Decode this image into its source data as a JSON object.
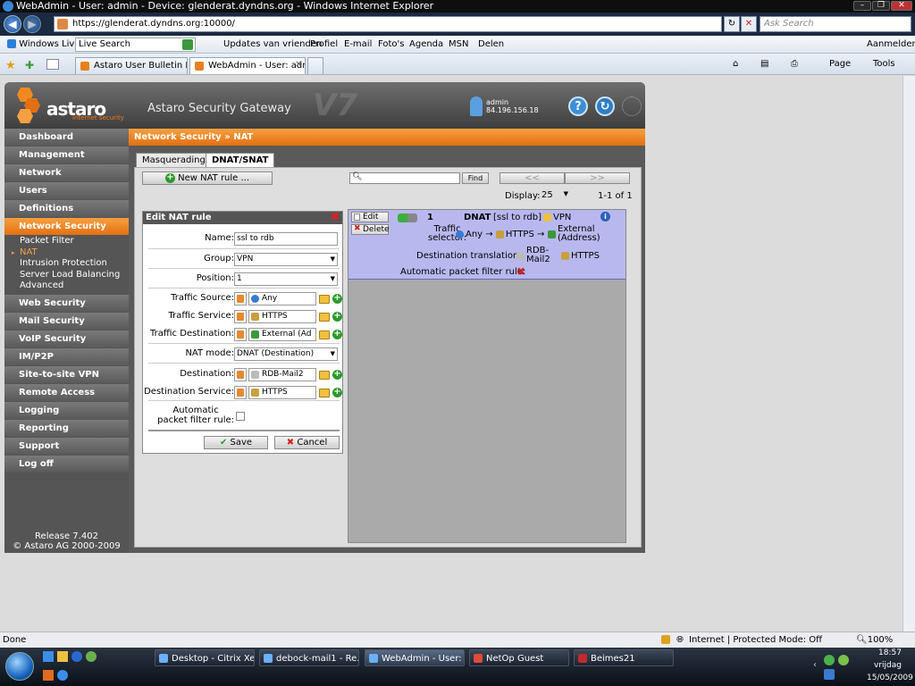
{
  "window": {
    "title": "WebAdmin - User: admin - Device: glenderat.dyndns.org - Windows Internet Explorer"
  },
  "browser": {
    "url": "https://glenderat.dyndns.org:10000/",
    "search_placeholder": "Ask Search",
    "links_toolbar": {
      "windows_live": "Windows Live",
      "live_search": "Live Search",
      "items": [
        "Updates van vrienden",
        "Profiel",
        "E-mail",
        "Foto's",
        "Agenda",
        "MSN",
        "Delen"
      ],
      "signin": "Aanmelden"
    },
    "tabs": [
      {
        "label": "Astaro User Bulletin Board ..."
      },
      {
        "label": "WebAdmin - User: adm..."
      }
    ],
    "cmd": {
      "page": "Page",
      "tools": "Tools"
    },
    "status": {
      "left": "Done",
      "zone": "Internet | Protected Mode: Off",
      "zoom": "100%"
    }
  },
  "app": {
    "brand": "astaro",
    "brand_sub": "internet security",
    "product": "Astaro Security Gateway",
    "version_big": "V7",
    "admin_user": "admin",
    "admin_ip": "84.196.156.18",
    "sidebar": [
      {
        "label": "Dashboard"
      },
      {
        "label": "Management"
      },
      {
        "label": "Network"
      },
      {
        "label": "Users"
      },
      {
        "label": "Definitions"
      },
      {
        "label": "Network Security"
      },
      {
        "label": "Web Security"
      },
      {
        "label": "Mail Security"
      },
      {
        "label": "VoIP Security"
      },
      {
        "label": "IM/P2P"
      },
      {
        "label": "Site-to-site VPN"
      },
      {
        "label": "Remote Access"
      },
      {
        "label": "Logging"
      },
      {
        "label": "Reporting"
      },
      {
        "label": "Support"
      },
      {
        "label": "Log off"
      }
    ],
    "subitems": [
      "Packet Filter",
      "NAT",
      "Intrusion Protection",
      "Server Load Balancing",
      "Advanced"
    ],
    "release": "Release 7.402",
    "copyright": "© Astaro AG 2000-2009",
    "breadcrumb": "Network Security » NAT",
    "tabs": [
      "Masquerading",
      "DNAT/SNAT"
    ],
    "new_rule_label": "New NAT rule ...",
    "find_label": "Find",
    "pager_prev": "<<",
    "pager_next": ">>",
    "display_label": "Display:",
    "display_value": "25",
    "count": "1-1 of 1",
    "edit": {
      "title": "Edit NAT rule",
      "name_label": "Name:",
      "name_value": "ssl to rdb",
      "group_label": "Group:",
      "group_value": "VPN",
      "position_label": "Position:",
      "position_value": "1",
      "tsrc_label": "Traffic Source:",
      "tsrc_value": "Any",
      "tsvc_label": "Traffic Service:",
      "tsvc_value": "HTTPS",
      "tdst_label": "Traffic Destination:",
      "tdst_value": "External (Ad",
      "natmode_label": "NAT mode:",
      "natmode_value": "DNAT (Destination)",
      "dest_label": "Destination:",
      "dest_value": "RDB-Mail2",
      "destsvc_label": "Destination Service:",
      "destsvc_value": "HTTPS",
      "auto_label_1": "Automatic",
      "auto_label_2": "packet filter rule:",
      "save": "Save",
      "cancel": "Cancel"
    },
    "rule": {
      "edit": "Edit",
      "delete": "Delete",
      "number": "1",
      "type": "DNAT",
      "name": "[ssl to rdb]",
      "group": "VPN",
      "traffic_selector_1": "Traffic",
      "traffic_selector_2": "selector:",
      "src": "Any",
      "arrow": "→",
      "svc": "HTTPS",
      "dst_1": "External",
      "dst_2": "(Address)",
      "dest_trans_label": "Destination translation:",
      "dest_host_1": "RDB-",
      "dest_host_2": "Mail2",
      "dest_svc": "HTTPS",
      "auto_pf_label": "Automatic packet filter rule:"
    }
  },
  "taskbar": {
    "tasks": [
      "Desktop - Citrix Xen...",
      "debock-mail1 - Re...",
      "WebAdmin - User: a...",
      "NetOp Guest",
      "Beimes21"
    ],
    "time": "18:57",
    "day": "vrijdag",
    "date": "15/05/2009"
  },
  "colors": {
    "accent": "#e97a16",
    "rule_bg": "#b8b8ef",
    "sidebar": "#5a5a5a"
  }
}
